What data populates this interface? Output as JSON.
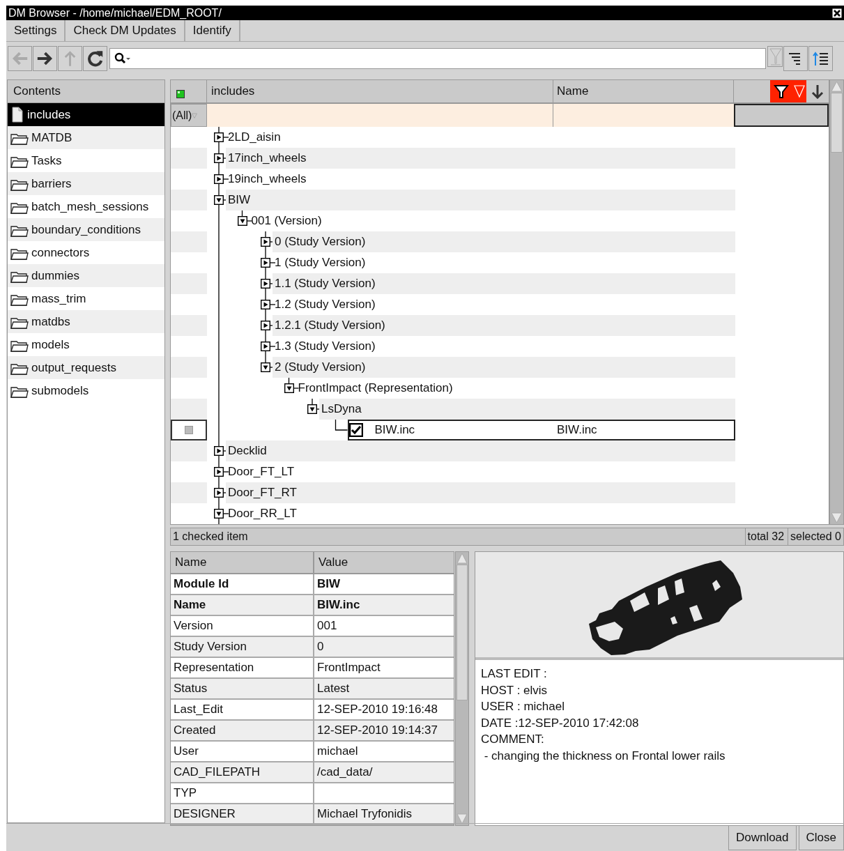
{
  "window": {
    "title": "DM Browser - /home/michael/EDM_ROOT/"
  },
  "menu": [
    {
      "label": "Settings"
    },
    {
      "label": "Check DM Updates"
    },
    {
      "label": "Identify"
    }
  ],
  "toolbar": {
    "buttons": [
      {
        "kind": "back",
        "disabled": true
      },
      {
        "kind": "forward",
        "disabled": false
      },
      {
        "kind": "up",
        "disabled": true
      },
      {
        "kind": "refresh",
        "disabled": false
      }
    ],
    "right_buttons": [
      {
        "kind": "filter",
        "disabled": true
      },
      {
        "kind": "list",
        "disabled": false
      },
      {
        "kind": "list-up",
        "disabled": false
      }
    ]
  },
  "sidebar": {
    "header": "Contents",
    "items": [
      {
        "label": "includes",
        "kind": "file",
        "selected": true
      },
      {
        "label": "MATDB",
        "kind": "folder",
        "selected": false
      },
      {
        "label": "Tasks",
        "kind": "folder",
        "selected": false
      },
      {
        "label": "barriers",
        "kind": "folder",
        "selected": false
      },
      {
        "label": "batch_mesh_sessions",
        "kind": "folder",
        "selected": false
      },
      {
        "label": "boundary_conditions",
        "kind": "folder",
        "selected": false
      },
      {
        "label": "connectors",
        "kind": "folder",
        "selected": false
      },
      {
        "label": "dummies",
        "kind": "folder",
        "selected": false
      },
      {
        "label": "mass_trim",
        "kind": "folder",
        "selected": false
      },
      {
        "label": "matdbs",
        "kind": "folder",
        "selected": false
      },
      {
        "label": "models",
        "kind": "folder",
        "selected": false
      },
      {
        "label": "output_requests",
        "kind": "folder",
        "selected": false
      },
      {
        "label": "submodels",
        "kind": "folder",
        "selected": false
      }
    ]
  },
  "tree": {
    "columns": [
      "includes",
      "Name"
    ],
    "header_buttons": [
      {
        "kind": "filter",
        "on": true
      },
      {
        "kind": "triangle",
        "on": true
      },
      {
        "kind": "sort-down",
        "on": false
      }
    ],
    "filter": "(All)",
    "nodes": [
      {
        "label": "2LD_aisin",
        "expanded": false
      },
      {
        "label": "17inch_wheels",
        "expanded": false
      },
      {
        "label": "19inch_wheels",
        "expanded": false
      },
      {
        "label": "BIW",
        "expanded": true,
        "children": [
          {
            "label": "001 (Version)",
            "expanded": true,
            "children": [
              {
                "label": "0 (Study Version)",
                "expanded": false
              },
              {
                "label": "1 (Study Version)",
                "expanded": false
              },
              {
                "label": "1.1 (Study Version)",
                "expanded": false
              },
              {
                "label": "1.2 (Study Version)",
                "expanded": false
              },
              {
                "label": "1.2.1 (Study Version)",
                "expanded": false
              },
              {
                "label": "1.3 (Study Version)",
                "expanded": false
              },
              {
                "label": "2 (Study Version)",
                "expanded": true,
                "children": [
                  {
                    "label": "FrontImpact (Representation)",
                    "expanded": true,
                    "children": [
                      {
                        "label": "LsDyna",
                        "expanded": true,
                        "children": [
                          {
                            "label": "BIW.inc",
                            "kind": "file",
                            "checked": true,
                            "current": true,
                            "name": "BIW.inc"
                          }
                        ]
                      }
                    ]
                  }
                ]
              }
            ]
          }
        ]
      },
      {
        "label": "Decklid",
        "expanded": false
      },
      {
        "label": "Door_FT_LT",
        "expanded": false
      },
      {
        "label": "Door_FT_RT",
        "expanded": false
      },
      {
        "label": "Door_RR_LT",
        "expanded": true
      }
    ]
  },
  "status_bar": {
    "checked": "1 checked item",
    "total": "total 32",
    "selected": "selected 0"
  },
  "properties": {
    "columns": [
      "Name",
      "Value"
    ],
    "rows": [
      {
        "name": "Module Id",
        "value": "BIW",
        "bold": true
      },
      {
        "name": "Name",
        "value": "BIW.inc",
        "bold": true
      },
      {
        "name": "Version",
        "value": "001",
        "bold": false
      },
      {
        "name": "Study Version",
        "value": "0",
        "bold": false
      },
      {
        "name": "Representation",
        "value": "FrontImpact",
        "bold": false
      },
      {
        "name": "Status",
        "value": "Latest",
        "bold": false
      },
      {
        "name": "Last_Edit",
        "value": "12-SEP-2010  19:16:48",
        "bold": false
      },
      {
        "name": "Created",
        "value": "12-SEP-2010  19:14:37",
        "bold": false
      },
      {
        "name": "User",
        "value": "michael",
        "bold": false
      },
      {
        "name": "CAD_FILEPATH",
        "value": "/cad_data/",
        "bold": false
      },
      {
        "name": "TYP",
        "bold": false
      },
      {
        "name": "DESIGNER",
        "value": "Michael Tryfonidis",
        "bold": false
      }
    ]
  },
  "preview": {
    "kind": "picture"
  },
  "details": [
    "LAST EDIT :",
    "HOST : elvis",
    "USER : michael",
    "DATE :12-SEP-2010 17:42:08",
    "COMMENT:",
    " - changing the thickness on Frontal lower rails"
  ],
  "buttons": [
    "Download",
    "Close"
  ]
}
